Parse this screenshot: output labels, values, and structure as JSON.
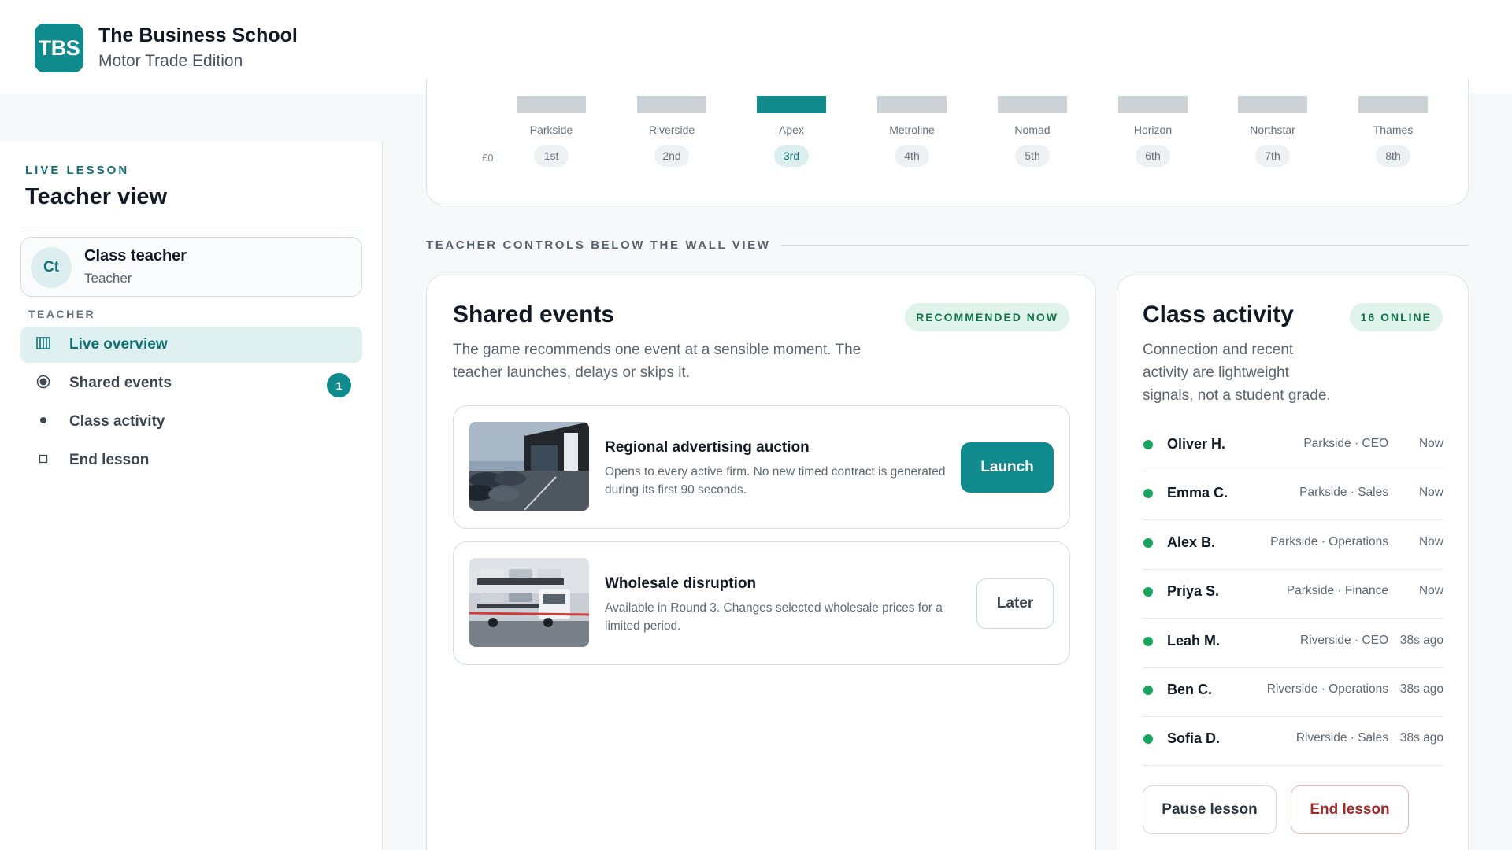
{
  "header": {
    "logo_text": "TBS",
    "title": "The Business School",
    "subtitle": "Motor Trade Edition"
  },
  "sidebar": {
    "eyebrow": "LIVE LESSON",
    "title": "Teacher view",
    "user": {
      "initials": "Ct",
      "name": "Class teacher",
      "role": "Teacher"
    },
    "section_label": "TEACHER",
    "items": [
      {
        "label": "Live overview",
        "icon": "chart-bars-icon",
        "active": true
      },
      {
        "label": "Shared events",
        "icon": "radio-target-icon",
        "badge": "1"
      },
      {
        "label": "Class activity",
        "icon": "dot-icon"
      },
      {
        "label": "End lesson",
        "icon": "square-icon"
      }
    ]
  },
  "chart": {
    "y_zero_label": "£0",
    "highlight_color": "#0f8a8d",
    "bars": [
      {
        "name": "Parkside",
        "rank": "1st",
        "highlight": false
      },
      {
        "name": "Riverside",
        "rank": "2nd",
        "highlight": false
      },
      {
        "name": "Apex",
        "rank": "3rd",
        "highlight": true
      },
      {
        "name": "Metroline",
        "rank": "4th",
        "highlight": false
      },
      {
        "name": "Nomad",
        "rank": "5th",
        "highlight": false
      },
      {
        "name": "Horizon",
        "rank": "6th",
        "highlight": false
      },
      {
        "name": "Northstar",
        "rank": "7th",
        "highlight": false
      },
      {
        "name": "Thames",
        "rank": "8th",
        "highlight": false
      }
    ]
  },
  "section_heading": "TEACHER CONTROLS BELOW THE WALL VIEW",
  "shared_events": {
    "title": "Shared events",
    "badge": "RECOMMENDED NOW",
    "description_line1": "The game recommends one event at a sensible moment. The",
    "description_line2": "teacher launches, delays or skips it.",
    "events": [
      {
        "title": "Regional advertising auction",
        "description": "Opens to every active firm. No new timed contract is generated during its first 90 seconds.",
        "action": "Launch",
        "image": "car-dealership-photo"
      },
      {
        "title": "Wholesale disruption",
        "description": "Available in Round 3. Changes selected wholesale prices for a limited period.",
        "action": "Later",
        "image": "car-transporter-truck-photo"
      }
    ]
  },
  "class_activity": {
    "title": "Class activity",
    "badge": "16 ONLINE",
    "description_line1": "Connection and recent",
    "description_line2": "activity are lightweight",
    "description_line3": "signals, not a student grade.",
    "online_color": "#17a45c",
    "rows": [
      {
        "name": "Oliver H.",
        "meta": "Parkside · CEO",
        "time": "Now"
      },
      {
        "name": "Emma C.",
        "meta": "Parkside · Sales",
        "time": "Now"
      },
      {
        "name": "Alex B.",
        "meta": "Parkside · Operations",
        "time": "Now"
      },
      {
        "name": "Priya S.",
        "meta": "Parkside · Finance",
        "time": "Now"
      },
      {
        "name": "Leah M.",
        "meta": "Riverside · CEO",
        "time": "38s ago"
      },
      {
        "name": "Ben C.",
        "meta": "Riverside · Operations",
        "time": "38s ago"
      },
      {
        "name": "Sofia D.",
        "meta": "Riverside · Sales",
        "time": "38s ago"
      }
    ],
    "pause_label": "Pause lesson",
    "end_label": "End lesson"
  }
}
